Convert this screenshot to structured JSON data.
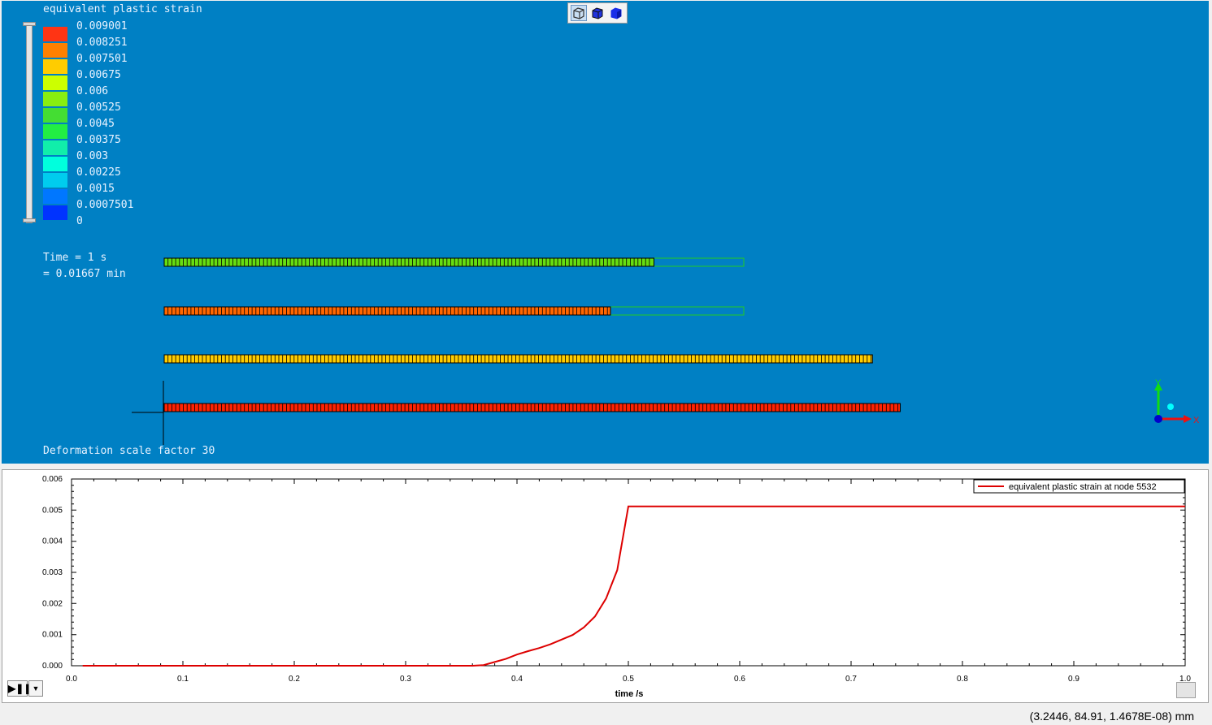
{
  "viewport": {
    "legend": {
      "title": "equivalent plastic strain",
      "labels": [
        "0.009001",
        "0.008251",
        "0.007501",
        "0.00675",
        "0.006",
        "0.00525",
        "0.0045",
        "0.00375",
        "0.003",
        "0.00225",
        "0.0015",
        "0.0007501",
        "0"
      ],
      "colors": [
        "#ff3414",
        "#ff8000",
        "#ffcc00",
        "#ccff00",
        "#88ee11",
        "#44dd33",
        "#22ee44",
        "#11eeaa",
        "#00ffdd",
        "#00ccee",
        "#0077ff",
        "#0033ff"
      ]
    },
    "time_line1": "Time = 1 s",
    "time_line2": "= 0.01667 min",
    "deformation_label": "Deformation scale factor 30",
    "view_buttons": [
      "view-wireframe-icon",
      "view-shaded-edges-icon",
      "view-shaded-icon"
    ],
    "axis_x": "X",
    "axis_y": "Y",
    "bars": [
      {
        "color": "#66dd11",
        "fraction": 0.845
      },
      {
        "color": "#ff6600",
        "fraction": 0.77
      },
      {
        "color": "#ffcc00",
        "fraction": 1.222
      },
      {
        "color": "#ff2200",
        "fraction": 1.27
      }
    ]
  },
  "plot": {
    "legend_label": "equivalent plastic strain at node 5532",
    "play_label": "▶❚❚",
    "menu_label": "▼"
  },
  "status": {
    "coords": "(3.2446, 84.91, 1.4678E-08) mm"
  },
  "chart_data": {
    "type": "line",
    "title": "",
    "xlabel": "time /s",
    "ylabel": "",
    "xlim": [
      0,
      1
    ],
    "ylim": [
      0,
      0.006
    ],
    "x_ticks": [
      "0.0",
      "0.1",
      "0.2",
      "0.3",
      "0.4",
      "0.5",
      "0.6",
      "0.7",
      "0.8",
      "0.9",
      "1.0"
    ],
    "y_ticks": [
      "0.000",
      "0.001",
      "0.002",
      "0.003",
      "0.004",
      "0.005",
      "0.006"
    ],
    "series": [
      {
        "name": "equivalent plastic strain at node 5532",
        "color": "#dd0000",
        "x": [
          0.01,
          0.36,
          0.37,
          0.38,
          0.39,
          0.4,
          0.41,
          0.42,
          0.43,
          0.44,
          0.45,
          0.46,
          0.47,
          0.48,
          0.49,
          0.5,
          0.55,
          0.6,
          0.7,
          0.8,
          0.9,
          1.0
        ],
        "y": [
          0,
          0,
          2e-05,
          0.00012,
          0.00022,
          0.00036,
          0.00047,
          0.00057,
          0.00069,
          0.00084,
          0.00099,
          0.00123,
          0.00158,
          0.00216,
          0.00307,
          0.00512,
          0.00512,
          0.00512,
          0.00512,
          0.00512,
          0.00512,
          0.00512
        ]
      }
    ]
  }
}
